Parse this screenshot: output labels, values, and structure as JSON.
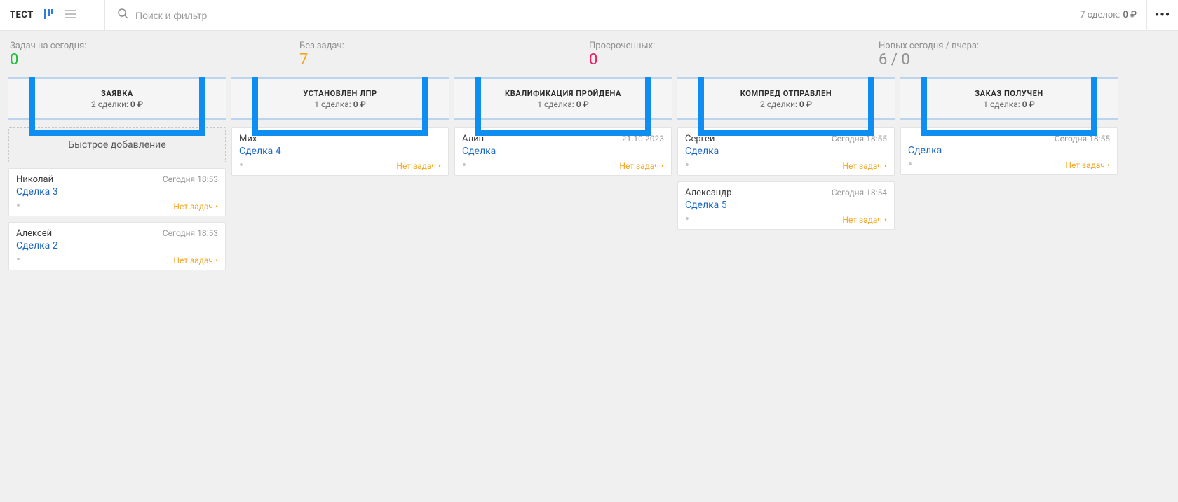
{
  "header": {
    "title": "ТЕСТ",
    "search_placeholder": "Поиск и фильтр",
    "summary_label": "7 сделок:",
    "summary_amount": "0 ₽"
  },
  "stats": [
    {
      "label": "Задач на сегодня:",
      "value": "0",
      "color": "v-green"
    },
    {
      "label": "Без задач:",
      "value": "7",
      "color": "v-orange"
    },
    {
      "label": "Просроченных:",
      "value": "0",
      "color": "v-pink"
    },
    {
      "label": "Новых сегодня / вчера:",
      "value": "6 / 0",
      "color": "v-grey"
    }
  ],
  "quick_add_label": "Быстрое добавление",
  "no_tasks_label": "Нет задач",
  "columns": [
    {
      "title": "ЗАЯВКА",
      "sub": "2 сделки:",
      "amt": "0 ₽",
      "quick_add": true,
      "cards": [
        {
          "contact": "Николай",
          "time": "Сегодня 18:53",
          "deal": "Сделка 3"
        },
        {
          "contact": "Алексей",
          "time": "Сегодня 18:53",
          "deal": "Сделка 2"
        }
      ]
    },
    {
      "title": "УСТАНОВЛЕН ЛПР",
      "sub": "1 сделка:",
      "amt": "0 ₽",
      "cards": [
        {
          "contact": "Мих",
          "time": "",
          "deal": "Сделка 4"
        }
      ]
    },
    {
      "title": "КВАЛИФИКАЦИЯ ПРОЙДЕНА",
      "sub": "1 сделка:",
      "amt": "0 ₽",
      "cards": [
        {
          "contact": "Алин",
          "time": "21.10.2023",
          "deal": "Сделка"
        }
      ]
    },
    {
      "title": "КОМПРЕД ОТПРАВЛЕН",
      "sub": "2 сделки:",
      "amt": "0 ₽",
      "cards": [
        {
          "contact": "Сергей",
          "time": "Сегодня 18:55",
          "deal": "Сделка"
        },
        {
          "contact": "Александр",
          "time": "Сегодня 18:54",
          "deal": "Сделка 5"
        }
      ]
    },
    {
      "title": "ЗАКАЗ ПОЛУЧЕН",
      "sub": "1 сделка:",
      "amt": "0 ₽",
      "cards": [
        {
          "contact": "",
          "time": "Сегодня 18:55",
          "deal": "Сделка"
        }
      ]
    }
  ]
}
